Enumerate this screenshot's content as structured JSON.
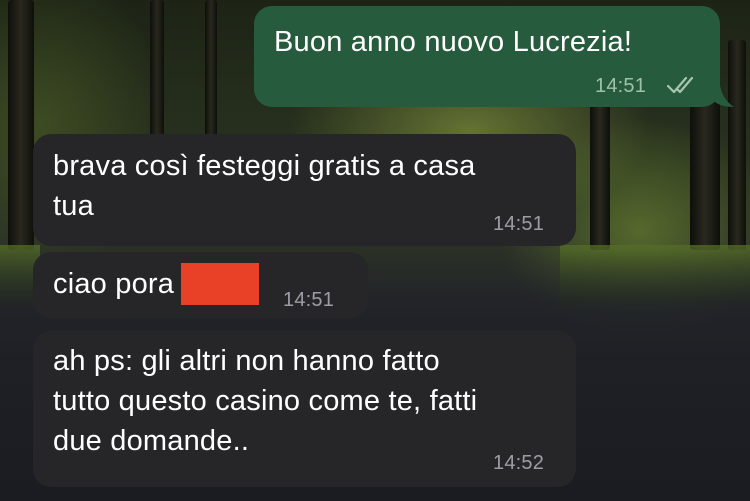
{
  "conversation": {
    "messages": [
      {
        "direction": "outgoing",
        "text": "Buon anno nuovo Lucrezia!",
        "time": "14:51",
        "status_icon": "read-double-check-icon"
      },
      {
        "direction": "incoming",
        "text": "brava così festeggi gratis a casa\ntua",
        "time": "14:51"
      },
      {
        "direction": "incoming",
        "text": "ciao pora",
        "time": "14:51",
        "redacted": true
      },
      {
        "direction": "incoming",
        "text": "ah ps: gli altri non hanno fatto\ntutto questo casino come te, fatti\ndue domande..",
        "time": "14:52"
      }
    ]
  },
  "colors": {
    "outgoing_bubble": "#275b3e",
    "incoming_bubble": "#262628",
    "redaction": "#e94128",
    "text": "#ffffff"
  }
}
